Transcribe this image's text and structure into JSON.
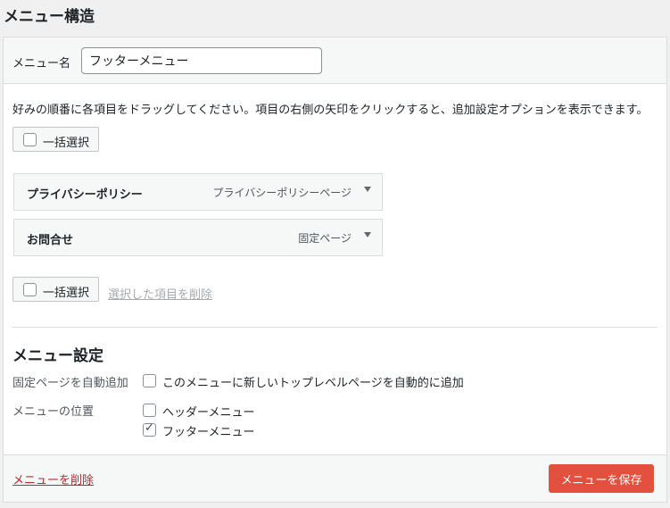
{
  "page": {
    "title": "メニュー構造"
  },
  "header": {
    "menu_name_label": "メニュー名",
    "menu_name_value": "フッターメニュー"
  },
  "instructions": "好みの順番に各項目をドラッグしてください。項目の右側の矢印をクリックすると、追加設定オプションを表示できます。",
  "bulk_select": {
    "label": "一括選択"
  },
  "menu_items": [
    {
      "title": "プライバシーポリシー",
      "type": "プライバシーポリシーページ"
    },
    {
      "title": "お問合せ",
      "type": "固定ページ"
    }
  ],
  "remove_selected_label": "選択した項目を削除",
  "settings": {
    "title": "メニュー設定",
    "auto_add_label": "固定ページを自動追加",
    "auto_add_option": "このメニューに新しいトップレベルページを自動的に追加",
    "auto_add_checked": false,
    "location_label": "メニューの位置",
    "locations": [
      {
        "label": "ヘッダーメニュー",
        "checked": false
      },
      {
        "label": "フッターメニュー",
        "checked": true
      }
    ]
  },
  "footer": {
    "delete_label": "メニューを削除",
    "save_label": "メニューを保存"
  },
  "colors": {
    "accent": "#e3503e",
    "danger_link": "#b32d2e"
  },
  "icons": {
    "checkmark": "✓",
    "expand": "chevron-down-icon"
  }
}
